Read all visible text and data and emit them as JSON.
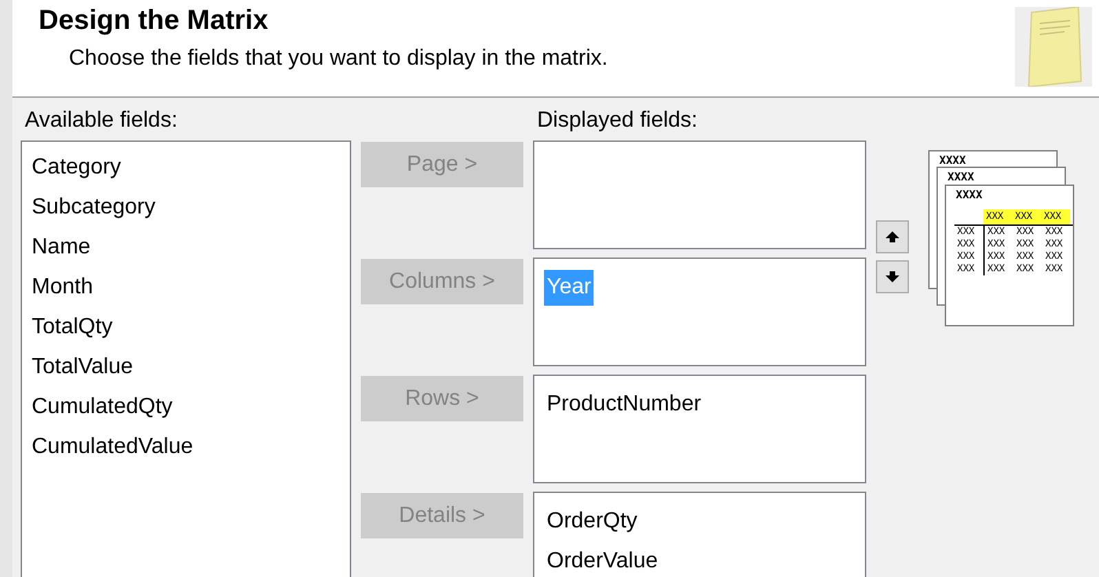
{
  "header": {
    "title": "Design the Matrix",
    "subtitle": "Choose the fields that you want to display in the matrix."
  },
  "available": {
    "label": "Available fields:",
    "items": [
      {
        "text": "Category",
        "selected": false
      },
      {
        "text": "Subcategory",
        "selected": false
      },
      {
        "text": "Name",
        "selected": false
      },
      {
        "text": "Month",
        "selected": false
      },
      {
        "text": "TotalQty",
        "selected": false
      },
      {
        "text": "TotalValue",
        "selected": false
      },
      {
        "text": "CumulatedQty",
        "selected": false
      },
      {
        "text": "CumulatedValue",
        "selected": false
      }
    ]
  },
  "displayed": {
    "label": "Displayed fields:",
    "groups": [
      {
        "button": "Page >",
        "disabled": true
      },
      {
        "button": "Columns >",
        "disabled": true,
        "items": [
          {
            "text": "Year",
            "selected": true
          }
        ]
      },
      {
        "button": "Rows >",
        "disabled": true,
        "items": [
          {
            "text": "ProductNumber",
            "selected": false
          }
        ]
      },
      {
        "button": "Details >",
        "disabled": true,
        "items": [
          {
            "text": "OrderQty",
            "selected": false
          },
          {
            "text": "OrderValue",
            "selected": false
          }
        ]
      }
    ]
  },
  "preview": {
    "titles": [
      "XXXX",
      "XXXX",
      "XXXX"
    ],
    "header_cells": [
      "XXX",
      "XXX",
      "XXX"
    ],
    "rows": [
      [
        "XXX",
        "XXX",
        "XXX",
        "XXX"
      ],
      [
        "XXX",
        "XXX",
        "XXX",
        "XXX"
      ],
      [
        "XXX",
        "XXX",
        "XXX",
        "XXX"
      ],
      [
        "XXX",
        "XXX",
        "XXX",
        "XXX"
      ]
    ]
  }
}
